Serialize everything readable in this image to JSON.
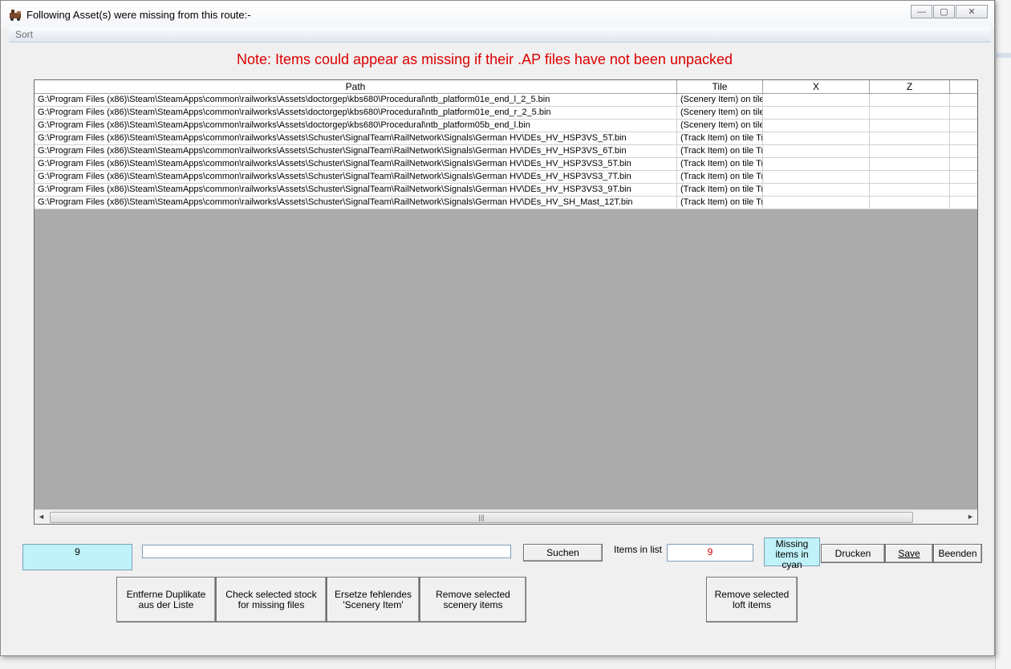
{
  "window": {
    "title": "Following Asset(s) were missing from this route:-",
    "minimize_glyph": "—",
    "maximize_glyph": "▢",
    "close_glyph": "✕",
    "app_icon": "train-icon"
  },
  "menu": {
    "sort": "Sort"
  },
  "note": "Note: Items could appear as missing if their .AP files have not been unpacked",
  "grid": {
    "columns": [
      "Path",
      "Tile",
      "X",
      "Z",
      ""
    ],
    "rows": [
      [
        "G:\\Program Files (x86)\\Steam\\SteamApps\\common\\railworks\\Assets\\doctorgep\\kbs680\\Procedural\\ntb_platform01e_end_l_2_5.bin",
        "(Scenery Item) on tile"
      ],
      [
        "G:\\Program Files (x86)\\Steam\\SteamApps\\common\\railworks\\Assets\\doctorgep\\kbs680\\Procedural\\ntb_platform01e_end_r_2_5.bin",
        "(Scenery Item) on tile"
      ],
      [
        "G:\\Program Files (x86)\\Steam\\SteamApps\\common\\railworks\\Assets\\doctorgep\\kbs680\\Procedural\\ntb_platform05b_end_l.bin",
        "(Scenery Item) on tile"
      ],
      [
        "G:\\Program Files (x86)\\Steam\\SteamApps\\common\\railworks\\Assets\\Schuster\\SignalTeam\\RailNetwork\\Signals\\German HV\\DEs_HV_HSP3VS_5T.bin",
        "(Track Item) on tile Tr"
      ],
      [
        "G:\\Program Files (x86)\\Steam\\SteamApps\\common\\railworks\\Assets\\Schuster\\SignalTeam\\RailNetwork\\Signals\\German HV\\DEs_HV_HSP3VS_6T.bin",
        "(Track Item) on tile Tr"
      ],
      [
        "G:\\Program Files (x86)\\Steam\\SteamApps\\common\\railworks\\Assets\\Schuster\\SignalTeam\\RailNetwork\\Signals\\German HV\\DEs_HV_HSP3VS3_5T.bin",
        "(Track Item) on tile Tr"
      ],
      [
        "G:\\Program Files (x86)\\Steam\\SteamApps\\common\\railworks\\Assets\\Schuster\\SignalTeam\\RailNetwork\\Signals\\German HV\\DEs_HV_HSP3VS3_7T.bin",
        "(Track Item) on tile Tr"
      ],
      [
        "G:\\Program Files (x86)\\Steam\\SteamApps\\common\\railworks\\Assets\\Schuster\\SignalTeam\\RailNetwork\\Signals\\German HV\\DEs_HV_HSP3VS3_9T.bin",
        "(Track Item) on tile Tr"
      ],
      [
        "G:\\Program Files (x86)\\Steam\\SteamApps\\common\\railworks\\Assets\\Schuster\\SignalTeam\\RailNetwork\\Signals\\German HV\\DEs_HV_SH_Mast_12T.bin",
        "(Track Item) on tile Tr"
      ]
    ],
    "scroll_left": "◄",
    "scroll_right": "►",
    "thumb_grip": "|||"
  },
  "controls": {
    "count_value": "9",
    "search_value": "",
    "search_button": "Suchen",
    "items_in_list_label": "Items in list",
    "items_in_list_value": "9",
    "missing_legend": "Missing items in cyan",
    "print_button": "Drucken",
    "save_button": "Save",
    "exit_button": "Beenden",
    "remove_duplicates_button": "Entferne Duplikate aus der Liste",
    "check_stock_button": "Check selected stock for missing files",
    "replace_scenery_button": "Ersetze fehlendes 'Scenery Item'",
    "remove_scenery_button": "Remove selected scenery items",
    "remove_loft_button": "Remove selected loft items"
  },
  "colors": {
    "note_red": "#dd0000",
    "cyan": "#bff3f9",
    "grid_empty": "#ababab"
  }
}
